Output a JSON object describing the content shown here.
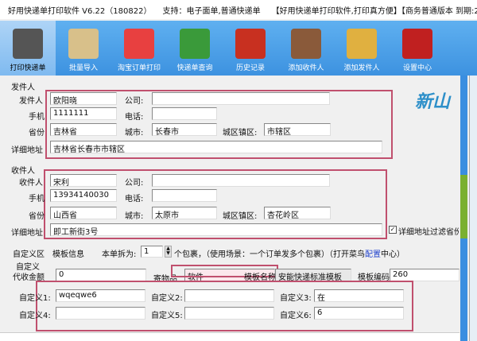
{
  "titlebar": {
    "title": "好用快递单打印软件 V6.22（180822）",
    "support": "支持：电子面单,普通快递单",
    "slogan": "【好用快递单打印软件,打印真方便】【商务普通版本  到期:2"
  },
  "toolbar": [
    {
      "label": "打印快递单",
      "icon": "printer-icon",
      "color": "#555"
    },
    {
      "label": "批量导入",
      "icon": "import-icon",
      "color": "#d8c08a"
    },
    {
      "label": "淘宝订单打印",
      "icon": "taobao-icon",
      "color": "#e84040"
    },
    {
      "label": "快递单查询",
      "icon": "truck-icon",
      "color": "#3a9a3a"
    },
    {
      "label": "历史记录",
      "icon": "book-icon",
      "color": "#c83020"
    },
    {
      "label": "添加收件人",
      "icon": "person-icon",
      "color": "#8a5a3a"
    },
    {
      "label": "添加发件人",
      "icon": "person-add-icon",
      "color": "#e0b040"
    },
    {
      "label": "设置中心",
      "icon": "settings-icon",
      "color": "#c02020"
    }
  ],
  "logo": "新山",
  "sender": {
    "group": "发件人",
    "name_label": "发件人",
    "name": "欧阳晓",
    "company_label": "公司:",
    "company": "",
    "mobile_label": "手机",
    "mobile": "1111111",
    "phone_label": "电话:",
    "phone": "",
    "province_label": "省份",
    "province": "吉林省",
    "city_label": "城市:",
    "city": "长春市",
    "district_label": "城区镇区:",
    "district": "市辖区",
    "address_label": "详细地址",
    "address": "吉林省长春市市辖区"
  },
  "receiver": {
    "group": "收件人",
    "name_label": "收件人",
    "name": "宋利",
    "company_label": "公司:",
    "company": "",
    "mobile_label": "手机",
    "mobile": "13934140030",
    "phone_label": "电话:",
    "phone": "",
    "province_label": "省份",
    "province": "山西省",
    "city_label": "城市:",
    "city": "太原市",
    "district_label": "城区镇区:",
    "district": "杏花岭区",
    "address_label": "详细地址",
    "address": "即工新街3号",
    "filter_label": "详细地址过滤省份",
    "filter_checked": true
  },
  "custom": {
    "area_label": "自定义区",
    "template_info": "模板信息",
    "split_label": "本单拆为:",
    "split_value": "1",
    "split_suffix": "个包裹，（使用场景：一个订单发多个包裹）（打开菜鸟",
    "config_link": "配置",
    "split_end": "中心）",
    "custom_label": "自定义",
    "cod_label": "代收金额",
    "cod": "0",
    "goods_label": "寄物品",
    "goods": "软件",
    "template_name_label": "模板名称:",
    "template_name": "安能快递标准模板",
    "template_code_label": "模板编码:",
    "template_code": "260",
    "fields": [
      {
        "label": "自定义1:",
        "value": "wqeqwe6"
      },
      {
        "label": "自定义2:",
        "value": ""
      },
      {
        "label": "自定义3:",
        "value": "在"
      },
      {
        "label": "自定义4:",
        "value": ""
      },
      {
        "label": "自定义5:",
        "value": ""
      },
      {
        "label": "自定义6:",
        "value": "6"
      }
    ]
  }
}
